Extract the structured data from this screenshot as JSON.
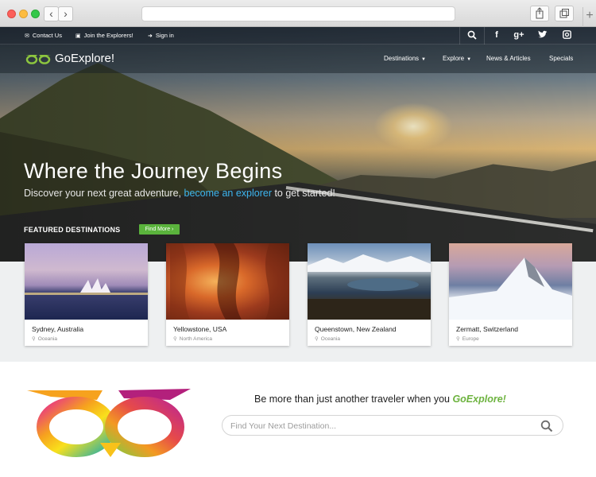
{
  "browser": {
    "back_glyph": "‹",
    "forward_glyph": "›",
    "new_tab_glyph": "+"
  },
  "topbar": {
    "contact": "Contact Us",
    "join": "Join the Explorers!",
    "signin": "Sign in",
    "social": [
      "f",
      "g+",
      "t",
      "ig"
    ]
  },
  "brand": {
    "name": "GoExplore!",
    "accent": "#6db33f",
    "link_color": "#3db5ef"
  },
  "nav": {
    "destinations": "Destinations",
    "explore": "Explore",
    "news": "News & Articles",
    "specials": "Specials"
  },
  "hero": {
    "title": "Where the Journey Begins",
    "sub_before": "Discover your next great adventure, ",
    "sub_link": "become an explorer",
    "sub_after": " to get started!"
  },
  "featured": {
    "label": "FEATURED DESTINATIONS",
    "button": "Find More ›",
    "cards": [
      {
        "title": "Sydney, Australia",
        "region": "Oceania"
      },
      {
        "title": "Yellowstone, USA",
        "region": "North America"
      },
      {
        "title": "Queenstown, New Zealand",
        "region": "Oceania"
      },
      {
        "title": "Zermatt, Switzerland",
        "region": "Europe"
      }
    ]
  },
  "lower": {
    "tagline": "Be more than just another traveler when you ",
    "tagline_brand": "GoExplore!",
    "search_placeholder": "Find Your Next Destination..."
  }
}
